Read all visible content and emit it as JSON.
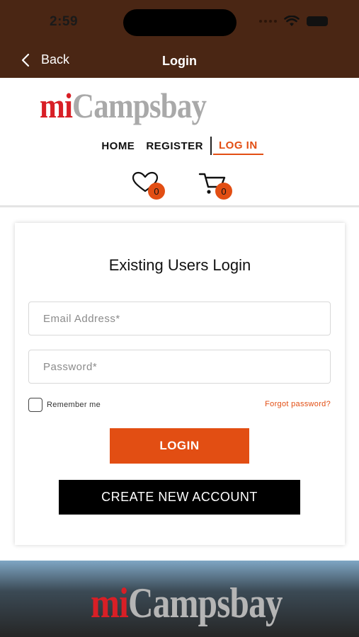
{
  "status": {
    "time": "2:59"
  },
  "navbar": {
    "back_label": "Back",
    "title": "Login"
  },
  "brand": {
    "prefix": "mi",
    "name": "Campsbay"
  },
  "menu": {
    "home": "HOME",
    "register": "REGISTER",
    "login": "LOG IN"
  },
  "counters": {
    "wishlist": "0",
    "cart": "0"
  },
  "login_form": {
    "title": "Existing Users Login",
    "email_placeholder": "Email Address*",
    "password_placeholder": "Password*",
    "remember_label": "Remember me",
    "forgot_label": "Forgot password?",
    "login_button": "LOGIN",
    "create_button": "CREATE NEW ACCOUNT"
  },
  "colors": {
    "header": "#4a2614",
    "accent": "#e24e13",
    "brand_red": "#d81f26"
  },
  "icons": [
    "chevron-left-icon",
    "wifi-icon",
    "battery-icon",
    "heart-icon",
    "cart-icon"
  ]
}
